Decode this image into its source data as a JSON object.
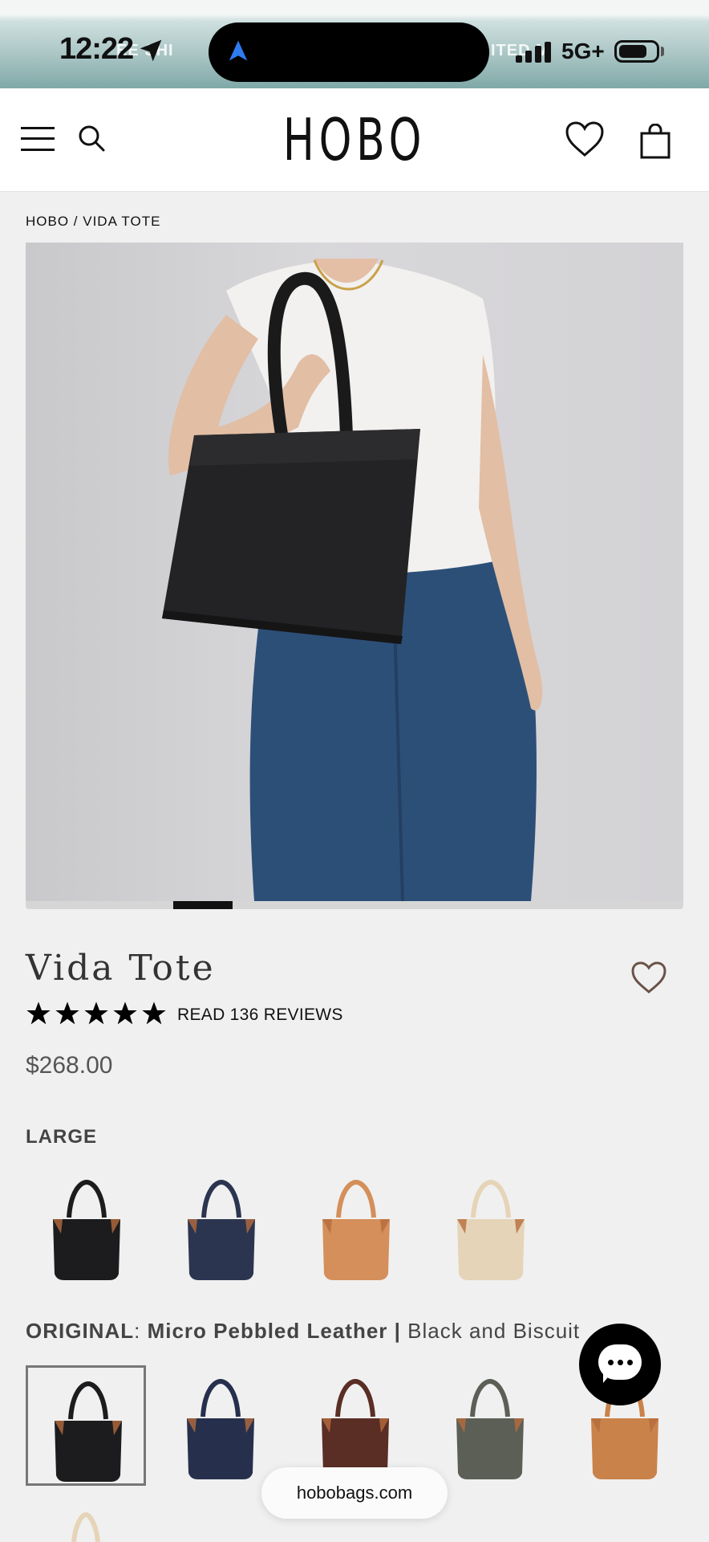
{
  "status_bar": {
    "time": "12:22",
    "network": "5G+",
    "promo_left_ghost": "EE SHI",
    "promo_right_ghost": "ITED M"
  },
  "header": {
    "logo": "HOBO"
  },
  "breadcrumb": "HOBO / VIDA TOTE",
  "product": {
    "title": "Vida Tote",
    "rating_stars": 5,
    "reviews_label": "READ 136 REVIEWS",
    "price": "$268.00",
    "image_carousel_position": 0.25
  },
  "size": {
    "label": "LARGE",
    "swatches": [
      {
        "name": "black",
        "color": "#1c1c1e"
      },
      {
        "name": "navy",
        "color": "#2c3550"
      },
      {
        "name": "biscuit",
        "color": "#d48f5a"
      },
      {
        "name": "cream",
        "color": "#e6d4b8"
      }
    ]
  },
  "material": {
    "prefix": "ORIGINAL",
    "separator": ":",
    "material_text": "Micro Pebbled Leather",
    "divider": "|",
    "color_text": "Black and Biscuit",
    "swatches": [
      {
        "name": "black",
        "color": "#1c1c1e",
        "selected": true
      },
      {
        "name": "navy",
        "color": "#26304d",
        "selected": false
      },
      {
        "name": "brown",
        "color": "#5a2e25",
        "selected": false
      },
      {
        "name": "olive",
        "color": "#5b5f55",
        "selected": false
      },
      {
        "name": "biscuit",
        "color": "#c9824a",
        "selected": false
      }
    ]
  },
  "browser": {
    "url": "hobobags.com"
  },
  "colors": {
    "background": "#f0f0f0",
    "header": "#ffffff",
    "heart_outline": "#6b5248"
  }
}
